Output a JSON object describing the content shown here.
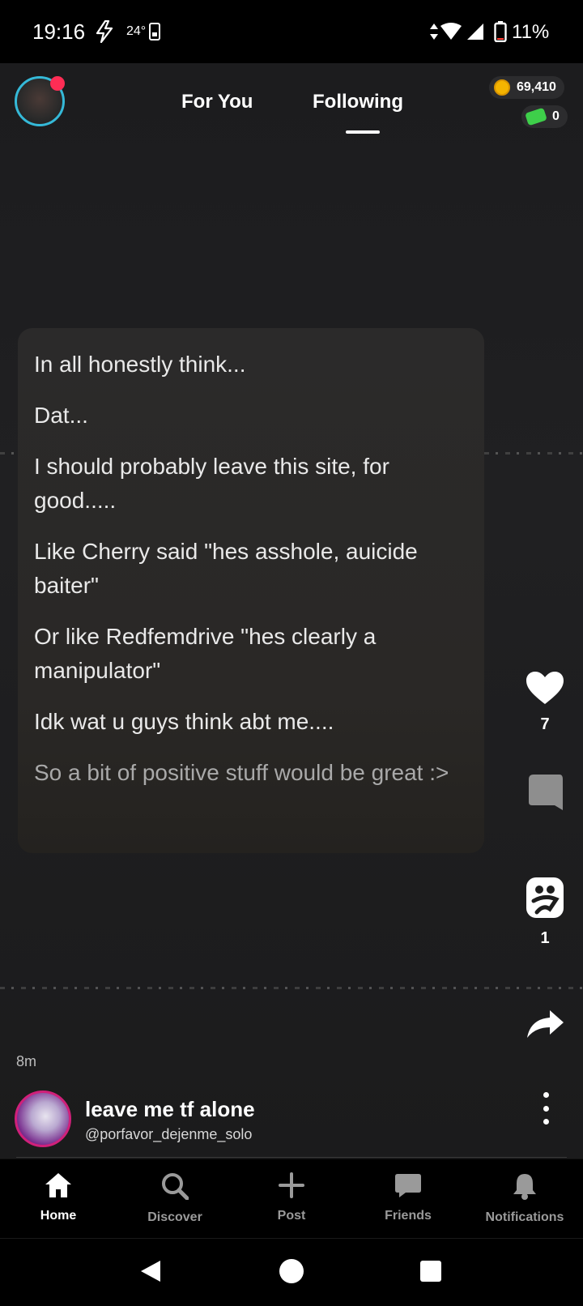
{
  "status_bar": {
    "time": "19:16",
    "temperature": "24°",
    "battery_percent": "11%"
  },
  "top_nav": {
    "tabs": [
      {
        "label": "For You",
        "active": false
      },
      {
        "label": "Following",
        "active": true
      }
    ],
    "coins": "69,410",
    "bucks": "0",
    "coin_color": "#f4b400",
    "bucks_color": "#3ecf4a"
  },
  "post": {
    "lines": [
      "In all honestly think...",
      "Dat...",
      "I should probably leave this site, for good.....",
      "Like Cherry said \"hes asshole, auicide baiter\"",
      "Or like Redfemdrive \"hes clearly a manipulator\"",
      "Idk wat u guys think abt me....",
      "So a bit of positive stuff would be great :>"
    ],
    "time_ago": "8m",
    "author_name": "leave me tf alone",
    "author_handle": "@porfavor_dejenme_solo"
  },
  "actions": {
    "like_count": "7",
    "repost_count": "1",
    "icons": [
      "heart-icon",
      "comment-icon",
      "repost-icon",
      "share-icon",
      "more-icon"
    ]
  },
  "bottom_nav": {
    "items": [
      {
        "label": "Home",
        "icon": "home-icon",
        "active": true
      },
      {
        "label": "Discover",
        "icon": "search-icon",
        "active": false
      },
      {
        "label": "Post",
        "icon": "plus-icon",
        "active": false
      },
      {
        "label": "Friends",
        "icon": "chat-icon",
        "active": false
      },
      {
        "label": "Notifications",
        "icon": "bell-icon",
        "active": false
      }
    ]
  },
  "colors": {
    "accent": "#35b9d8",
    "notification_dot": "#ff2d55"
  }
}
